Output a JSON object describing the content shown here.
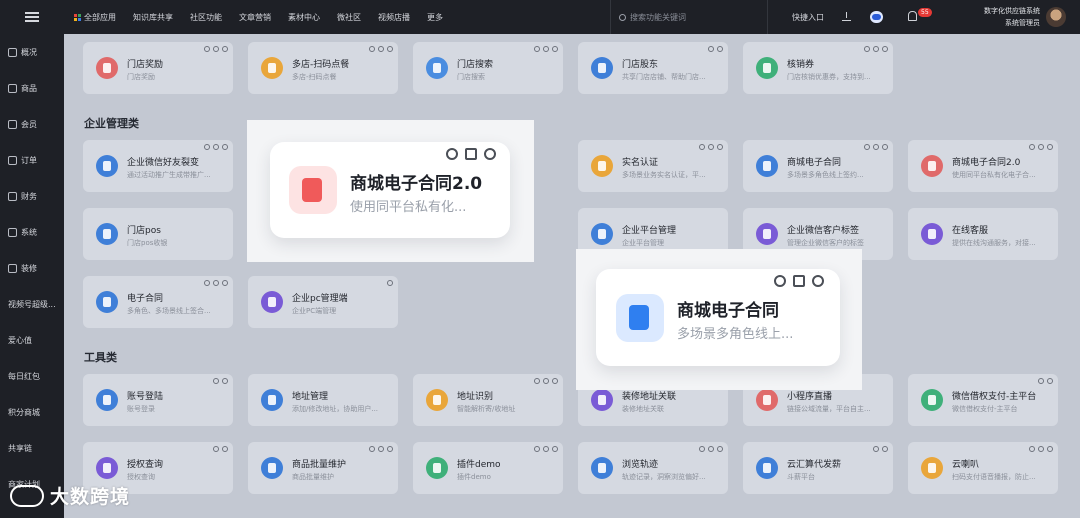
{
  "topnav": {
    "items": [
      "全部应用",
      "知识库共享",
      "社区功能",
      "文章营销",
      "素材中心",
      "微社区",
      "视频店播",
      "更多"
    ],
    "search_placeholder": "搜索功能关键词",
    "quick_entry": "快捷入口",
    "notification_count": "55",
    "user_line1": "数字化供应链系统",
    "user_line2": "系统管理员"
  },
  "sidebar": {
    "items": [
      "概况",
      "商品",
      "会员",
      "订单",
      "财务",
      "系统",
      "装修",
      "视频号超级...",
      "爱心值",
      "每日红包",
      "积分商城",
      "共享链",
      "商家计划"
    ]
  },
  "sections": {
    "enterprise": "企业管理类",
    "tools": "工具类"
  },
  "cards": {
    "row1": [
      {
        "title": "门店奖励",
        "desc": "门店奖励",
        "color": "#e06a6a"
      },
      {
        "title": "多店-扫码点餐",
        "desc": "多店-扫码点餐",
        "color": "#e9a63a"
      },
      {
        "title": "门店搜索",
        "desc": "门店搜索",
        "color": "#4a8de0"
      },
      {
        "title": "门店股东",
        "desc": "共享门店店铺、帮助门店...",
        "color": "#3f7fd8"
      },
      {
        "title": "核销券",
        "desc": "门店核销优惠券，支持到...",
        "color": "#3fb07a"
      }
    ],
    "row2": [
      {
        "title": "企业微信好友裂变",
        "desc": "通过活动推广生成带推广...",
        "color": "#3f7fd8"
      },
      {
        "title": "实名认证",
        "desc": "多场景业务实名认证，平...",
        "color": "#e9a63a"
      },
      {
        "title": "商城电子合同",
        "desc": "多场景多角色线上签约...",
        "color": "#3f7fd8"
      },
      {
        "title": "商城电子合同2.0",
        "desc": "使用同平台私有化电子合...",
        "color": "#e06a6a"
      }
    ],
    "row3": [
      {
        "title": "门店pos",
        "desc": "门店pos收银",
        "color": "#3f7fd8"
      },
      {
        "title": "企业平台管理",
        "desc": "企业平台管理",
        "color": "#3f7fd8"
      },
      {
        "title": "企业微信客户标签",
        "desc": "管理企业微信客户的标签",
        "color": "#7a5bd6"
      },
      {
        "title": "在线客服",
        "desc": "提供在线沟通服务，对接...",
        "color": "#7a5bd6"
      }
    ],
    "row4": [
      {
        "title": "电子合同",
        "desc": "多角色、多场景线上签合...",
        "color": "#3f7fd8"
      },
      {
        "title": "企业pc管理端",
        "desc": "企业PC端管理",
        "color": "#7a5bd6"
      }
    ],
    "row5": [
      {
        "title": "账号登陆",
        "desc": "账号登录",
        "color": "#3f7fd8"
      },
      {
        "title": "地址管理",
        "desc": "添加/修改地址，协助用户...",
        "color": "#3f7fd8"
      },
      {
        "title": "地址识别",
        "desc": "智能解析寄/收地址",
        "color": "#e9a63a"
      },
      {
        "title": "装修地址关联",
        "desc": "装修地址关联",
        "color": "#7a5bd6"
      },
      {
        "title": "小程序直播",
        "desc": "链接公域流量，平台自主...",
        "color": "#e06a6a"
      },
      {
        "title": "微信借权支付-主平台",
        "desc": "微信借权支付-主平台",
        "color": "#3fb07a"
      }
    ],
    "row6": [
      {
        "title": "授权查询",
        "desc": "授权查询",
        "color": "#7a5bd6"
      },
      {
        "title": "商品批量维护",
        "desc": "商品批量维护",
        "color": "#3f7fd8"
      },
      {
        "title": "插件demo",
        "desc": "插件demo",
        "color": "#3fb07a"
      },
      {
        "title": "浏览轨迹",
        "desc": "轨迹记录，洞察浏览偏好...",
        "color": "#3f7fd8"
      },
      {
        "title": "云汇算代发薪",
        "desc": "斗薪平台",
        "color": "#3f7fd8"
      },
      {
        "title": "云喇叭",
        "desc": "扫码支付语音播报，防止...",
        "color": "#e9a63a"
      }
    ]
  },
  "zoom_cards": {
    "contract2": {
      "title": "商城电子合同2.0",
      "desc": "使用同平台私有化...",
      "color": "#f05a5a"
    },
    "contract": {
      "title": "商城电子合同",
      "desc": "多场景多角色线上...",
      "color": "#2f7ff0"
    }
  },
  "watermark": "大数跨境"
}
